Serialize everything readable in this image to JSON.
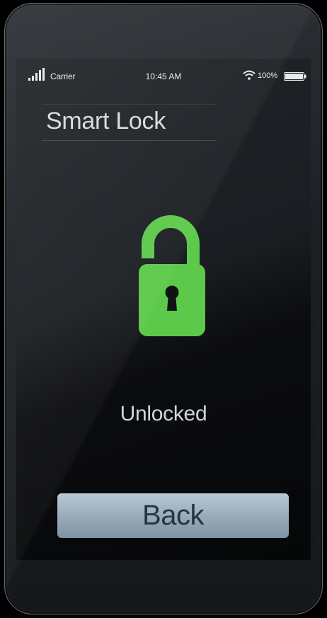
{
  "status_bar": {
    "carrier": "Carrier",
    "time": "10:45 AM",
    "battery_percent": "100%"
  },
  "header": {
    "title": "Smart Lock"
  },
  "lock": {
    "state": "Unlocked",
    "color": "#5cc94a"
  },
  "actions": {
    "back_label": "Back"
  },
  "icons": [
    "signal-icon",
    "wifi-icon",
    "battery-icon",
    "unlocked-padlock-icon"
  ],
  "colors": {
    "accent": "#5cc94a",
    "button": "#9aacbb",
    "button_text": "#263545"
  }
}
